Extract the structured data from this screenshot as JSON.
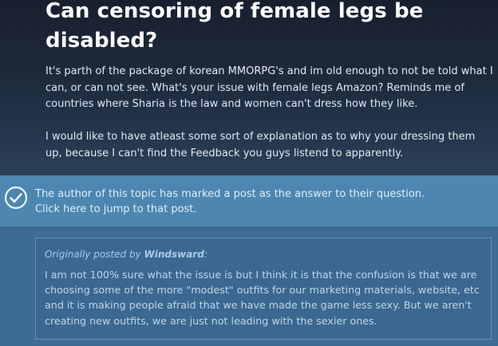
{
  "topic": {
    "title": "Can censoring of female legs be disabled?",
    "paragraphs": [
      "It's parth of the package of korean MMORPG's and im old enough to not be told what I can, or can not see. What's your issue with female legs Amazon? Reminds me of countries where Sharia is the law and women can't dress how they like.",
      "I would like to have atleast some sort of explanation as to why your dressing them up, because I can't find the Feedback you guys listend to apparently."
    ]
  },
  "answer_banner": {
    "line1": "The author of this topic has marked a post as the answer to their question.",
    "line2": "Click here to jump to that post.",
    "icon": "check-circle-icon"
  },
  "quote": {
    "prefix": "Originally posted by ",
    "author": "Windsward",
    "suffix": ":",
    "text": "I am not 100% sure what the issue is but I think it is that the confusion is that we are choosing some of the more \"modest\" outfits for our marketing materials, website, etc and it is making people afraid that we have made the game less sexy. But we aren't creating new outfits, we are just not leading with the sexier ones."
  },
  "colors": {
    "header_bg": "#1b2838",
    "banner_bg": "#4d86b1",
    "content_bg": "#3d6c93",
    "accent_text": "#ddeffb"
  }
}
